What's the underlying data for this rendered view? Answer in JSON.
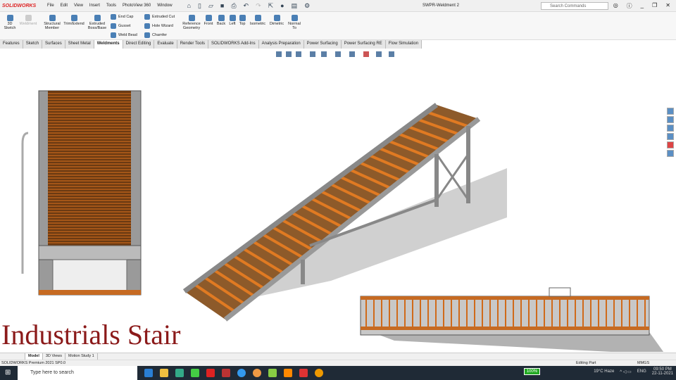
{
  "app": {
    "logo": "SOLIDWORKS",
    "document_title": "SWPR-Weldment 2",
    "search_placeholder": "Search Commands"
  },
  "menu": [
    "File",
    "Edit",
    "View",
    "Insert",
    "Tools",
    "PhotoView 360",
    "Window"
  ],
  "ribbon": {
    "sketch3d": "3D Sketch",
    "weldment": "Weldment",
    "structural": "Structural Member",
    "trim": "Trim/Extend",
    "extruded_boss": "Extruded Boss/Base",
    "end_cap": "End Cap",
    "gusset": "Gusset",
    "weld_bead": "Weld Bead",
    "extruded_cut": "Extruded Cut",
    "hole_wizard": "Hole Wizard",
    "chamfer": "Chamfer",
    "ref_geom": "Reference Geometry",
    "front": "Front",
    "back": "Back",
    "left": "Left",
    "top": "Top",
    "isometric": "Isometric",
    "dimetric": "Dimetric",
    "normal_to": "Normal To"
  },
  "tabs": [
    "Features",
    "Sketch",
    "Surfaces",
    "Sheet Metal",
    "Weldments",
    "Direct Editing",
    "Evaluate",
    "Render Tools",
    "SOLIDWORKS Add-Ins",
    "Analysis Preparation",
    "Power Surfacing",
    "Power Surfacing RE",
    "Flow Simulation"
  ],
  "active_tab": "Weldments",
  "overlay_title": "Industrials Stair",
  "bottom_tabs": [
    "Model",
    "3D Views",
    "Motion Study 1"
  ],
  "status": {
    "version": "SOLIDWORKS Premium 2021 SP0.0",
    "mode": "Editing Part",
    "units": "MMGS"
  },
  "taskbar": {
    "search": "Type here to search",
    "battery": "100%",
    "weather": "19°C  Haze",
    "lang": "ENG",
    "time": "09:50 PM",
    "date": "22-11-2021"
  }
}
